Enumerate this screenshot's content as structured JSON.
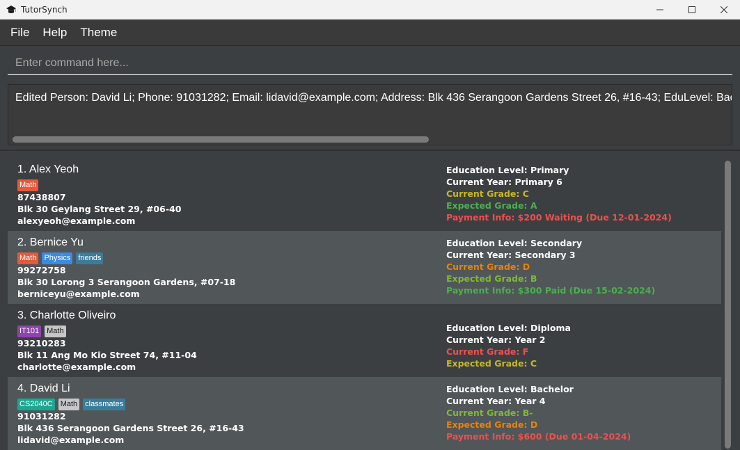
{
  "window": {
    "title": "TutorSynch"
  },
  "menu": {
    "items": [
      "File",
      "Help",
      "Theme"
    ]
  },
  "command": {
    "placeholder": "Enter command here...",
    "value": ""
  },
  "result": {
    "text": "Edited Person: David Li; Phone: 91031282; Email: lidavid@example.com; Address: Blk 436 Serangoon Gardens Street 26, #16-43; EduLevel: Bachelor"
  },
  "colors": {
    "white": "#ffffff",
    "yellow": "#c7b81f",
    "green": "#4caf50",
    "lime": "#7fb83a",
    "orange": "#e8820e",
    "red": "#ef4f4f",
    "tag_math": "#e8583a",
    "tag_physics": "#3b8ae6",
    "tag_friends": "#3a7d9a",
    "tag_it101": "#8e44ad",
    "tag_gray": "#c7c7c7",
    "tag_cs2040c": "#1aa892",
    "tag_classmates": "#3a7d9a"
  },
  "persons": [
    {
      "name": "1. Alex Yeoh",
      "tags": [
        {
          "label": "Math",
          "color": "#e8583a",
          "dark": false
        }
      ],
      "phone": "87438807",
      "address": "Blk 30 Geylang Street 29, #06-40",
      "email": "alexyeoh@example.com",
      "details": [
        {
          "text": "Education Level: Primary",
          "color": "#ffffff"
        },
        {
          "text": "Current Year: Primary 6",
          "color": "#ffffff"
        },
        {
          "text": "Current Grade: C",
          "color": "#c7b81f"
        },
        {
          "text": "Expected Grade: A",
          "color": "#4caf50"
        },
        {
          "text": "Payment Info: $200 Waiting (Due 12-01-2024)",
          "color": "#ef4f4f"
        }
      ]
    },
    {
      "name": "2. Bernice Yu",
      "tags": [
        {
          "label": "Math",
          "color": "#e8583a",
          "dark": false
        },
        {
          "label": "Physics",
          "color": "#3b8ae6",
          "dark": false
        },
        {
          "label": "friends",
          "color": "#3a7d9a",
          "dark": false
        }
      ],
      "phone": "99272758",
      "address": "Blk 30 Lorong 3 Serangoon Gardens, #07-18",
      "email": "berniceyu@example.com",
      "details": [
        {
          "text": "Education Level: Secondary",
          "color": "#ffffff"
        },
        {
          "text": "Current Year: Secondary 3",
          "color": "#ffffff"
        },
        {
          "text": "Current Grade: D",
          "color": "#e8820e"
        },
        {
          "text": "Expected Grade: B",
          "color": "#7fb83a"
        },
        {
          "text": "Payment Info: $300 Paid (Due 15-02-2024)",
          "color": "#4caf50"
        }
      ]
    },
    {
      "name": "3. Charlotte Oliveiro",
      "tags": [
        {
          "label": "IT101",
          "color": "#8e44ad",
          "dark": false
        },
        {
          "label": "Math",
          "color": "#c7c7c7",
          "dark": true
        }
      ],
      "phone": "93210283",
      "address": "Blk 11 Ang Mo Kio Street 74, #11-04",
      "email": "charlotte@example.com",
      "details": [
        {
          "text": "",
          "color": "#ffffff"
        },
        {
          "text": "Education Level: Diploma",
          "color": "#ffffff"
        },
        {
          "text": "Current Year: Year 2",
          "color": "#ffffff"
        },
        {
          "text": "Current Grade: F",
          "color": "#ef4f4f"
        },
        {
          "text": "Expected Grade: C",
          "color": "#c7b81f"
        }
      ]
    },
    {
      "name": "4. David Li",
      "tags": [
        {
          "label": "CS2040C",
          "color": "#1aa892",
          "dark": false
        },
        {
          "label": "Math",
          "color": "#c7c7c7",
          "dark": true
        },
        {
          "label": "classmates",
          "color": "#3a7d9a",
          "dark": false
        }
      ],
      "phone": "91031282",
      "address": "Blk 436 Serangoon Gardens Street 26, #16-43",
      "email": "lidavid@example.com",
      "details": [
        {
          "text": "Education Level: Bachelor",
          "color": "#ffffff"
        },
        {
          "text": "Current Year: Year 4",
          "color": "#ffffff"
        },
        {
          "text": "Current Grade: B-",
          "color": "#7fb83a"
        },
        {
          "text": "Expected Grade: D",
          "color": "#e8820e"
        },
        {
          "text": "Payment Info: $600 (Due 01-04-2024)",
          "color": "#ef4f4f"
        }
      ]
    }
  ]
}
